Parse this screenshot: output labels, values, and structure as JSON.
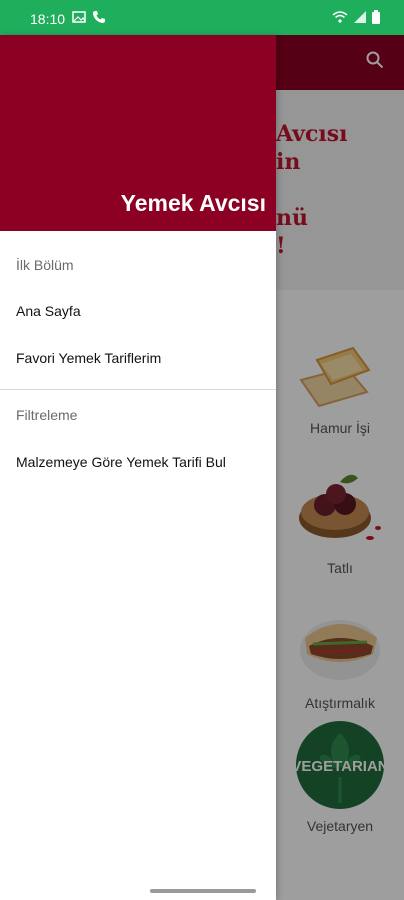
{
  "status": {
    "time": "18:10"
  },
  "app": {
    "name": "Yemek Avcısı",
    "accent": "#8c0023"
  },
  "banner": {
    "text": "Avcısı\nin\n\nnü\n!"
  },
  "categories": [
    {
      "label": "Hamur İşi"
    },
    {
      "label": "Tatlı"
    },
    {
      "label": "Atıştırmalık"
    },
    {
      "label": "Vejetaryen",
      "badge": "VEGETARIAN"
    }
  ],
  "drawer": {
    "header_title": "Yemek Avcısı",
    "section1": "İlk Bölüm",
    "items1": [
      {
        "label": "Ana Sayfa"
      },
      {
        "label": "Favori Yemek Tariflerim"
      }
    ],
    "section2": "Filtreleme",
    "items2": [
      {
        "label": "Malzemeye Göre Yemek Tarifi Bul"
      }
    ]
  },
  "icons": {
    "search": "search-icon",
    "menu": "drawer-menu"
  }
}
